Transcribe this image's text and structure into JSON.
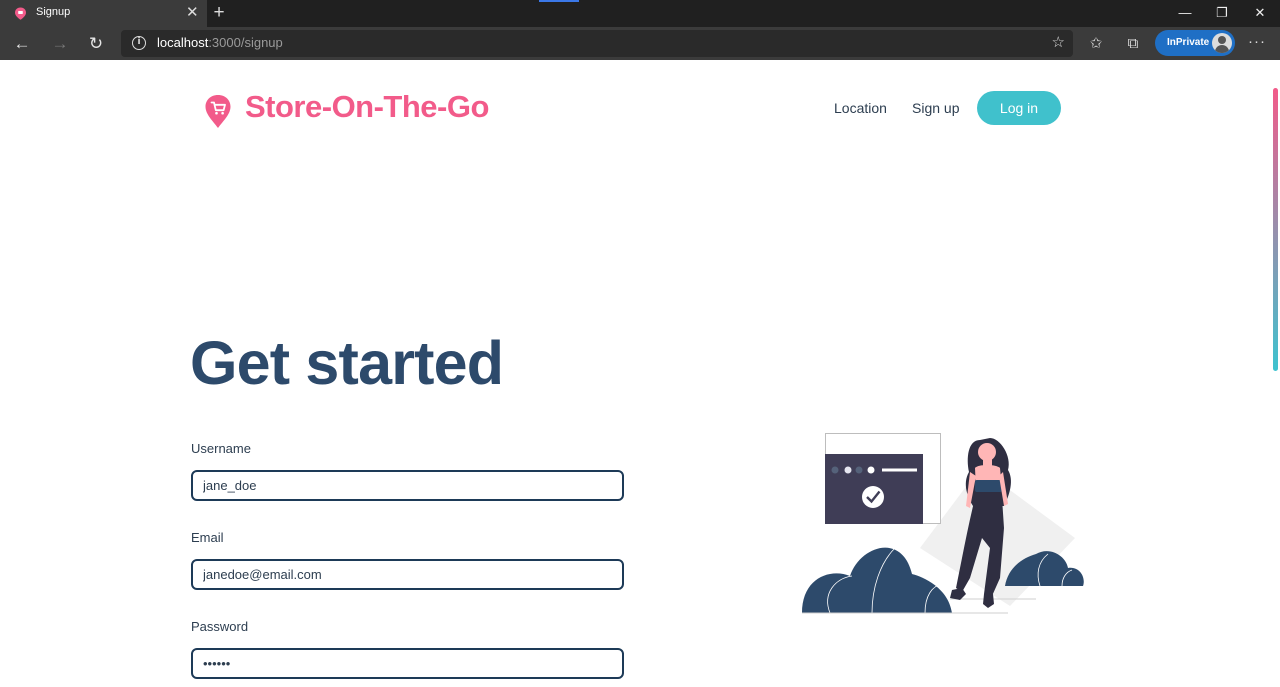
{
  "browser": {
    "tab_title": "Signup",
    "new_tab_symbol": "+",
    "url_host": "localhost",
    "url_path": ":3000/signup",
    "inprivate_label": "InPrivate",
    "window_minimize": "—",
    "window_restore": "❐",
    "window_close": "✕",
    "back_symbol": "←",
    "forward_symbol": "→",
    "reload_symbol": "↻",
    "info_symbol": "i",
    "star_symbol": "☆",
    "favorites_symbol": "✩",
    "collections_symbol": "⧉",
    "more_symbol": "···",
    "close_tab_symbol": "✕"
  },
  "header": {
    "brand": "Store-On-The-Go",
    "nav": {
      "location": "Location",
      "signup": "Sign up",
      "login": "Log in"
    }
  },
  "main": {
    "heading": "Get started",
    "fields": {
      "username": {
        "label": "Username",
        "value": "jane_doe"
      },
      "email": {
        "label": "Email",
        "value": "janedoe@email.com"
      },
      "password": {
        "label": "Password",
        "value": "••••••"
      }
    }
  },
  "colors": {
    "brand_pink": "#f25b8a",
    "accent_teal": "#40c1cc",
    "heading_navy": "#2d4a6b",
    "input_border": "#1d3a57"
  },
  "icons": {
    "logo": "map-pin-cart-icon",
    "illustration": "woman-checklist-illustration"
  }
}
